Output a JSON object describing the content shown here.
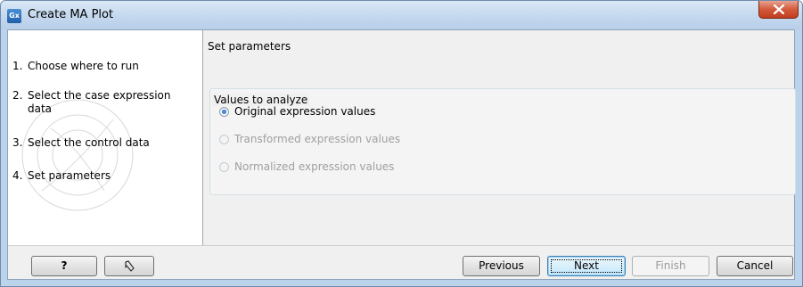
{
  "window": {
    "title": "Create MA Plot",
    "app_icon_text": "Gx"
  },
  "steps": [
    {
      "number": "1.",
      "label": "Choose where to run"
    },
    {
      "number": "2.",
      "label": "Select the case expression data"
    },
    {
      "number": "3.",
      "label": "Select the control data"
    },
    {
      "number": "4.",
      "label": "Set parameters"
    }
  ],
  "main": {
    "section_title": "Set parameters",
    "group_title": "Values to analyze",
    "options": [
      {
        "label": "Original expression values",
        "selected": true,
        "enabled": true
      },
      {
        "label": "Transformed expression values",
        "selected": false,
        "enabled": false
      },
      {
        "label": "Normalized expression values",
        "selected": false,
        "enabled": false
      }
    ]
  },
  "buttons": {
    "help": "?",
    "reset_icon": "reset-arrow-icon",
    "previous": "Previous",
    "next": "Next",
    "finish": "Finish",
    "cancel": "Cancel"
  },
  "colors": {
    "title_bar": "#c4d8ee",
    "close_button": "#d35a3c",
    "dialog_bg": "#f0f0f0",
    "default_button_border": "#3c7fb1"
  }
}
